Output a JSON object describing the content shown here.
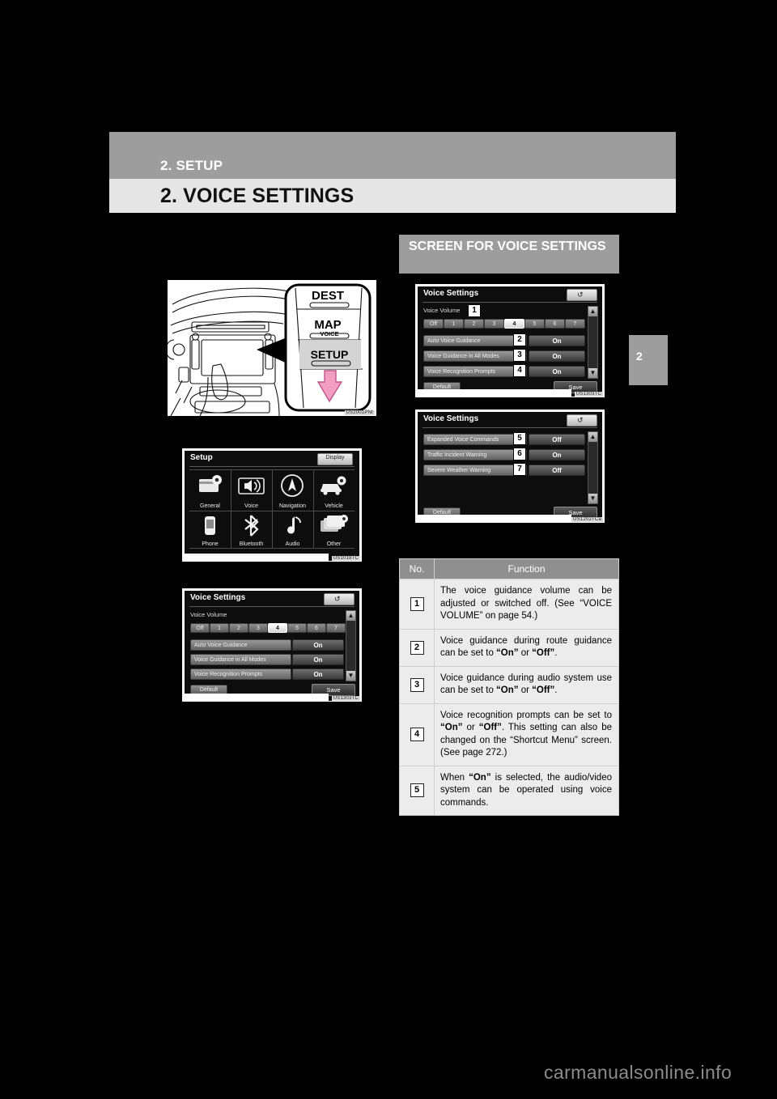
{
  "header": {
    "chapter": "2. SETUP",
    "title": "2. VOICE SETTINGS",
    "side_tab": "2"
  },
  "section": {
    "heading": "SCREEN FOR VOICE SETTINGS"
  },
  "dashboard_figure": {
    "buttons": [
      "DEST",
      "MAP",
      "SETUP"
    ],
    "map_sub_label": "VOICE",
    "highlight_button": "SETUP",
    "code": "US2001PNI"
  },
  "setup_screen": {
    "title": "Setup",
    "top_button": "Display",
    "items": [
      {
        "label": "General",
        "icon": "card-gear-icon"
      },
      {
        "label": "Voice",
        "icon": "speaker-icon"
      },
      {
        "label": "Navigation",
        "icon": "compass-icon"
      },
      {
        "label": "Vehicle",
        "icon": "car-gear-icon"
      },
      {
        "label": "Phone",
        "icon": "phone-icon"
      },
      {
        "label": "Bluetooth",
        "icon": "bluetooth-icon"
      },
      {
        "label": "Audio",
        "icon": "music-note-icon"
      },
      {
        "label": "Other",
        "icon": "stacked-cards-gear-icon"
      }
    ],
    "code": "US1018TC"
  },
  "voice_settings_screen_plain": {
    "title": "Voice Settings",
    "back_icon": "back-arrow-icon",
    "volume_label": "Voice Volume",
    "volume_options": [
      "Off",
      "1",
      "2",
      "3",
      "4",
      "5",
      "6",
      "7"
    ],
    "volume_selected": "4",
    "rows": [
      {
        "name": "Auto Voice Guidance",
        "value": "On"
      },
      {
        "name": "Voice Guidance in All Modes",
        "value": "On"
      },
      {
        "name": "Voice Recognition Prompts",
        "value": "On"
      }
    ],
    "default_button": "Default",
    "save_button": "Save",
    "code": "US1303TC"
  },
  "voice_settings_screen_1": {
    "title": "Voice Settings",
    "back_icon": "back-arrow-icon",
    "volume_label": "Voice Volume",
    "volume_options": [
      "Off",
      "1",
      "2",
      "3",
      "4",
      "5",
      "6",
      "7"
    ],
    "volume_selected": "4",
    "callouts": [
      "1",
      "2",
      "3",
      "4"
    ],
    "rows": [
      {
        "name": "Auto Voice Guidance",
        "value": "On",
        "callout": "2"
      },
      {
        "name": "Voice Guidance in All Modes",
        "value": "On",
        "callout": "3"
      },
      {
        "name": "Voice Recognition Prompts",
        "value": "On",
        "callout": "4"
      }
    ],
    "default_button": "Default",
    "save_button": "Save",
    "code": "US1303TC"
  },
  "voice_settings_screen_2": {
    "title": "Voice Settings",
    "back_icon": "back-arrow-icon",
    "rows": [
      {
        "name": "Expanded Voice Commands",
        "value": "Off",
        "callout": "5"
      },
      {
        "name": "Traffic Incident Warning",
        "value": "On",
        "callout": "6"
      },
      {
        "name": "Severe Weather Warning",
        "value": "Off",
        "callout": "7"
      }
    ],
    "default_button": "Default",
    "save_button": "Save",
    "code": "US1202TCa"
  },
  "function_table": {
    "columns": [
      "No.",
      "Function"
    ],
    "rows": [
      {
        "no": "1",
        "text": "The voice guidance volume can be adjusted or switched off. (See “VOICE VOLUME” on page 54.)"
      },
      {
        "no": "2",
        "text": "Voice guidance during route guidance can be set to “On” or “Off”."
      },
      {
        "no": "3",
        "text": "Voice guidance during audio system use can be set to “On” or “Off”."
      },
      {
        "no": "4",
        "text": "Voice recognition prompts can be set to “On” or “Off”. This setting can also be changed on the “Shortcut Menu” screen. (See page 272.)"
      },
      {
        "no": "5",
        "text": "When “On” is selected, the audio/video system can be operated using voice commands."
      }
    ]
  },
  "watermark": "carmanualsonline.info",
  "colors": {
    "page_background": "#000000",
    "header_gray": "#9d9d9d",
    "header_light": "#e6e6e6",
    "table_header": "#8f8f8f",
    "table_cell": "#ececec",
    "highlight_arrow": "#f19ec2"
  }
}
